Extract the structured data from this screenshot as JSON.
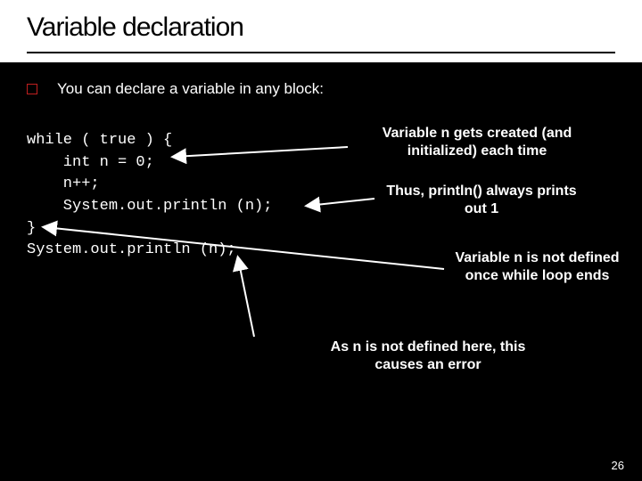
{
  "title": "Variable declaration",
  "bullet": "You can declare a variable in any block:",
  "code": {
    "l1": "while ( true ) {",
    "l2": "    int n = 0;",
    "l3": "    n++;",
    "l4": "    System.out.println (n);",
    "l5": "}",
    "l6": "System.out.println (n);"
  },
  "annot": {
    "created": "Variable n gets created (and initialized) each time",
    "prints1": "Thus, println() always prints out 1",
    "notdef": "Variable n is not defined once while loop ends",
    "error": "As n is not defined here, this causes an error"
  },
  "page": "26"
}
